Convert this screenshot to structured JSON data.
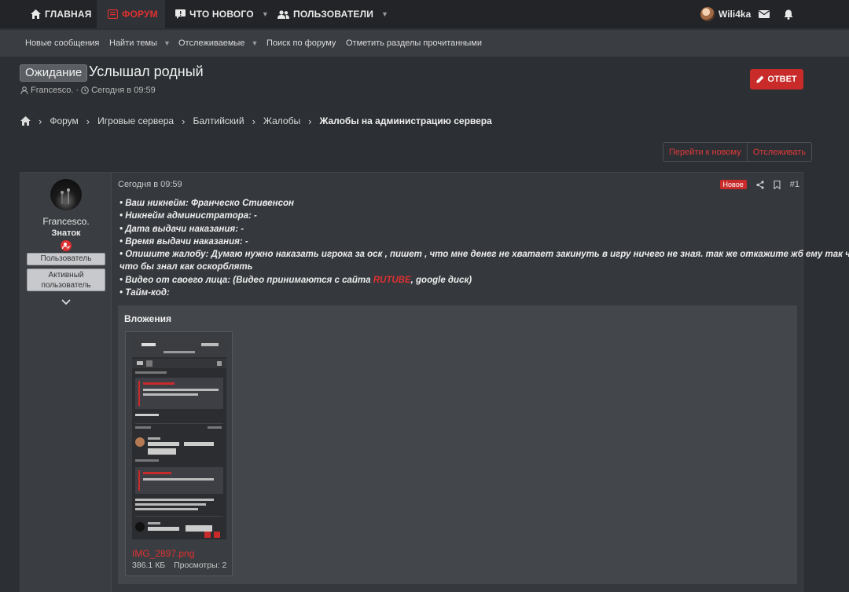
{
  "nav": {
    "tabs": [
      {
        "label": "ГЛАВНАЯ",
        "icon": "home-icon",
        "active": false
      },
      {
        "label": "ФОРУМ",
        "icon": "forum-icon",
        "active": true
      },
      {
        "label": "ЧТО НОВОГО",
        "icon": "chat-icon",
        "active": false
      },
      {
        "label": "ПОЛЬЗОВАТЕЛИ",
        "icon": "users-icon",
        "active": false
      }
    ],
    "user": "Wili4ka"
  },
  "subnav": [
    "Новые сообщения",
    "Найти темы",
    "Отслеживаемые",
    "Поиск по форуму",
    "Отметить разделы прочитанными"
  ],
  "thread": {
    "prefix": "Ожидание",
    "title": "Услышал родный",
    "author": "Francesco.",
    "date": "Сегодня в 09:59",
    "reply_label": "ОТВЕТ"
  },
  "breadcrumbs": [
    "Форум",
    "Игровые сервера",
    "Балтийский",
    "Жалобы",
    "Жалобы на администрацию сервера"
  ],
  "actions": {
    "goto_new": "Перейти к новому",
    "watch": "Отслеживать"
  },
  "post": {
    "user": {
      "name": "Francesco.",
      "title": "Знаток",
      "banners": [
        "Пользователь",
        "Активный пользователь"
      ]
    },
    "date": "Сегодня в 09:59",
    "new_badge": "Новое",
    "number": "#1",
    "lines": [
      "• Ваш никнейм: Франческо Стивенсон",
      "• Никнейм администратора: -",
      "• Дата выдачи наказания: -",
      "• Время выдачи наказания: -",
      "• Опишите жалобу: Думаю нужно наказать игрока за оск , пишет , что мне денег не хватает закинуть в игру ничего не зная. так же откажите жб ему так чисто",
      "что бы знал как оскорблять"
    ],
    "video_prefix": "• Видео от своего лица: (Видео принимаются с сайта ",
    "video_link": "RUTUBE",
    "video_suffix": ", google диск)",
    "timecode": "• Тайм-код:",
    "attachments_title": "Вложения",
    "attachment": {
      "name": "IMG_2897.png",
      "size": "386.1 КБ",
      "views": "Просмотры: 2"
    }
  },
  "colors": {
    "accent": "#e03131",
    "bg": "#2c2f33",
    "nav": "#222427"
  }
}
